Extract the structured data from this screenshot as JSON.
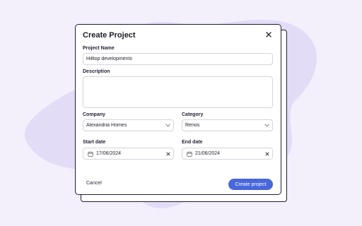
{
  "modal": {
    "title": "Create Project",
    "close_icon": "close-icon"
  },
  "form": {
    "project_name": {
      "label": "Project Name",
      "value": "Hilltop developments"
    },
    "description": {
      "label": "Description",
      "value": ""
    },
    "company": {
      "label": "Company",
      "value": "Alexandria Homes",
      "icon": "chevron-down-icon"
    },
    "category": {
      "label": "Category",
      "value": "Renos",
      "icon": "chevron-down-icon"
    },
    "start_date": {
      "label": "Start date",
      "value": "17/06/2024",
      "icon": "calendar-icon",
      "clear_icon": "clear-icon"
    },
    "end_date": {
      "label": "End date",
      "value": "21/06/2024",
      "icon": "calendar-icon",
      "clear_icon": "clear-icon"
    }
  },
  "actions": {
    "cancel_label": "Cancel",
    "create_label": "Create project"
  },
  "colors": {
    "background": "#f3f0fc",
    "blob": "#e3dcf7",
    "primary": "#4867dc",
    "border": "#1f2030"
  }
}
